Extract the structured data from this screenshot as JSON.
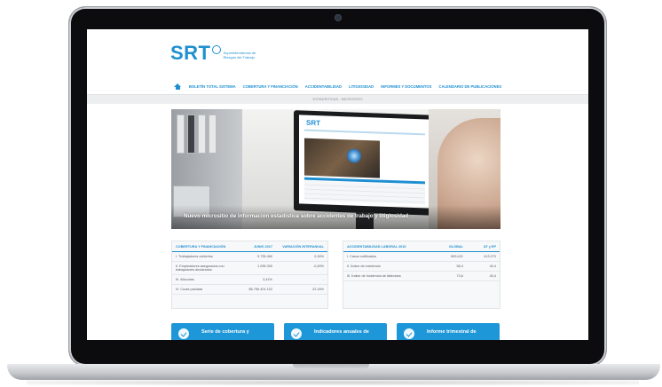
{
  "header": {
    "logo": "SRT",
    "logo_subtitle": "Superintendencia de Riesgos del Trabajo"
  },
  "nav": {
    "items": [
      "BOLETÍN TOTAL SISTEMA",
      "COBERTURA Y FINANCIACIÓN",
      "ACCIDENTABILIDAD",
      "LITIGIOSIDAD",
      "INFORMES Y DOCUMENTOS",
      "CALENDARIO DE PUBLICACIONES"
    ]
  },
  "breadcrumb": "ESTADÍSTICAS - MICROSITIO",
  "hero": {
    "caption": "Nuevo micrositio de información estadística sobre accidentes de trabajo y litigiosidad"
  },
  "coverage_table": {
    "headers": [
      "COBERTURA Y FINANCIACIÓN",
      "JUNIO 2017",
      "VARIACIÓN INTERANUAL"
    ],
    "rows": [
      [
        "I. Trabajadores cubiertos",
        "9.735.460",
        "0,34%"
      ],
      [
        "II. Empleadores asegurados con trabajadores declarados",
        "1.095.330",
        "-0,45%"
      ],
      [
        "III. Alícuotas",
        "3,41%",
        "-"
      ],
      [
        "IV. Cuota pactada",
        "$6.756.401.102",
        "22,16%"
      ]
    ]
  },
  "accident_table": {
    "headers": [
      "ACCIDENTABILIDAD LABORAL 2016",
      "GLOBAL",
      "AT y EP"
    ],
    "rows": [
      [
        "I. Casos notificados",
        "659.421",
        "413.270"
      ],
      [
        "II. Índice de incidencia",
        "58,4",
        "40,4"
      ],
      [
        "III. Índice de incidencia de fallecidos",
        "73,6",
        "40,4"
      ]
    ]
  },
  "cards": [
    {
      "label": "Serie de cobertura y"
    },
    {
      "label": "Indicadores anuales de"
    },
    {
      "label": "Informe trimestral de"
    }
  ],
  "colors": {
    "brand": "#1f8fd1",
    "card": "#1e97d9"
  }
}
